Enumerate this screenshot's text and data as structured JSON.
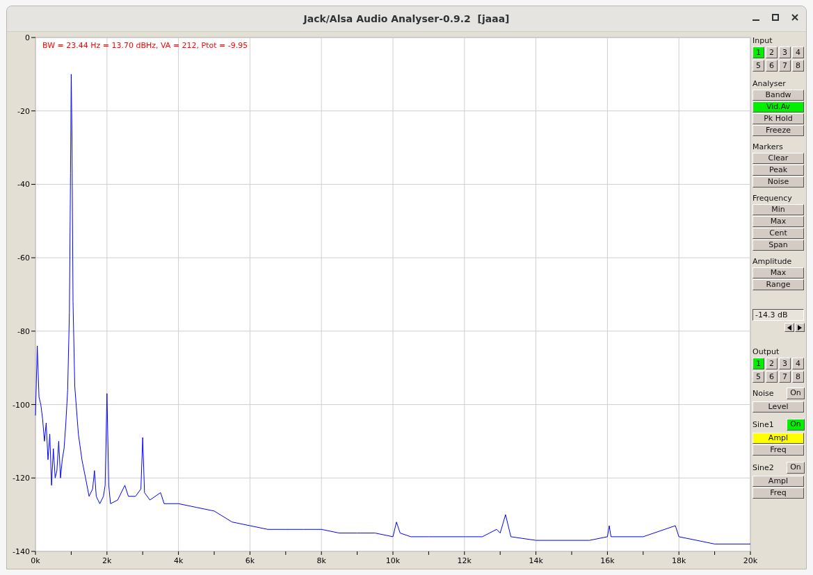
{
  "window": {
    "title": "Jack/Alsa Audio Analyser-0.9.2  [jaaa]"
  },
  "plot": {
    "readout": "BW = 23.44 Hz = 13.70 dBHz, VA = 212, Ptot = -9.95",
    "chart_data": {
      "type": "line",
      "xlim": [
        0,
        20000
      ],
      "ylim": [
        -140,
        0
      ],
      "xticks": [
        {
          "value": 0,
          "label": "0k"
        },
        {
          "value": 2000,
          "label": "2k"
        },
        {
          "value": 4000,
          "label": "4k"
        },
        {
          "value": 6000,
          "label": "6k"
        },
        {
          "value": 8000,
          "label": "8k"
        },
        {
          "value": 10000,
          "label": "10k"
        },
        {
          "value": 12000,
          "label": "12k"
        },
        {
          "value": 14000,
          "label": "14k"
        },
        {
          "value": 16000,
          "label": "16k"
        },
        {
          "value": 18000,
          "label": "18k"
        },
        {
          "value": 20000,
          "label": "20k"
        }
      ],
      "yticks": [
        0,
        -20,
        -40,
        -60,
        -80,
        -100,
        -120,
        -140
      ],
      "x": [
        0,
        50,
        100,
        150,
        200,
        250,
        300,
        350,
        400,
        450,
        500,
        550,
        600,
        650,
        700,
        750,
        800,
        850,
        900,
        950,
        980,
        1000,
        1020,
        1050,
        1100,
        1200,
        1300,
        1400,
        1500,
        1600,
        1650,
        1700,
        1800,
        1900,
        1950,
        2000,
        2050,
        2100,
        2300,
        2500,
        2600,
        2800,
        2950,
        3000,
        3050,
        3200,
        3500,
        3600,
        4000,
        4500,
        5000,
        5500,
        6000,
        6500,
        7000,
        7500,
        8000,
        8500,
        9000,
        9500,
        10000,
        10100,
        10200,
        10500,
        11000,
        12000,
        12500,
        12900,
        13000,
        13150,
        13300,
        14000,
        15000,
        15500,
        16000,
        16050,
        16100,
        17000,
        17900,
        18000,
        18500,
        19000,
        20000
      ],
      "grid": true,
      "series": [
        {
          "color": "#0000ff",
          "values": [
            -103,
            -84,
            -98,
            -100,
            -104,
            -110,
            -105,
            -115,
            -108,
            -122,
            -112,
            -120,
            -118,
            -110,
            -120,
            -115,
            -112,
            -105,
            -96,
            -75,
            -37,
            -10,
            -25,
            -72,
            -95,
            -108,
            -115,
            -120,
            -125,
            -123,
            -118,
            -125,
            -127,
            -125,
            -122,
            -97,
            -122,
            -127,
            -126,
            -122,
            -125,
            -125,
            -123,
            -109,
            -124,
            -126,
            -124,
            -127,
            -127,
            -128,
            -129,
            -132,
            -133,
            -134,
            -134,
            -134,
            -134,
            -135,
            -135,
            -135,
            -136,
            -132,
            -135,
            -136,
            -136,
            -136,
            -136,
            -134,
            -135,
            -130,
            -136,
            -137,
            -137,
            -137,
            -136,
            -133,
            -136,
            -136,
            -133,
            -136,
            -137,
            -138,
            -138
          ]
        }
      ]
    }
  },
  "panel": [
    {
      "kind": "heading",
      "text": "Input"
    },
    {
      "kind": "grid",
      "buttons": [
        {
          "label": "1",
          "selected": true
        },
        {
          "label": "2",
          "selected": false
        },
        {
          "label": "3",
          "selected": false
        },
        {
          "label": "4",
          "selected": false
        },
        {
          "label": "5",
          "selected": false
        },
        {
          "label": "6",
          "selected": false
        },
        {
          "label": "7",
          "selected": false
        },
        {
          "label": "8",
          "selected": false
        }
      ]
    },
    {
      "kind": "heading",
      "text": "Analyser"
    },
    {
      "kind": "button",
      "label": "Bandw",
      "on": false,
      "selected": false
    },
    {
      "kind": "button",
      "label": "Vid.Av",
      "on": true,
      "selected": false
    },
    {
      "kind": "button",
      "label": "Pk Hold",
      "on": false,
      "selected": false
    },
    {
      "kind": "button",
      "label": "Freeze",
      "on": false,
      "selected": false
    },
    {
      "kind": "heading",
      "text": "Markers"
    },
    {
      "kind": "button",
      "label": "Clear",
      "on": false,
      "selected": false
    },
    {
      "kind": "button",
      "label": "Peak",
      "on": false,
      "selected": false
    },
    {
      "kind": "button",
      "label": "Noise",
      "on": false,
      "selected": false
    },
    {
      "kind": "heading",
      "text": "Frequency"
    },
    {
      "kind": "button",
      "label": "Min",
      "on": false,
      "selected": false
    },
    {
      "kind": "button",
      "label": "Max",
      "on": false,
      "selected": false
    },
    {
      "kind": "button",
      "label": "Cent",
      "on": false,
      "selected": false
    },
    {
      "kind": "button",
      "label": "Span",
      "on": false,
      "selected": false
    },
    {
      "kind": "heading",
      "text": "Amplitude"
    },
    {
      "kind": "button",
      "label": "Max",
      "on": false,
      "selected": false
    },
    {
      "kind": "button",
      "label": "Range",
      "on": false,
      "selected": false
    },
    {
      "kind": "field",
      "value": "-14.3 dB"
    },
    {
      "kind": "arrows"
    },
    {
      "kind": "heading",
      "text": "Output"
    },
    {
      "kind": "grid",
      "buttons": [
        {
          "label": "1",
          "selected": true
        },
        {
          "label": "2",
          "selected": false
        },
        {
          "label": "3",
          "selected": false
        },
        {
          "label": "4",
          "selected": false
        },
        {
          "label": "5",
          "selected": false
        },
        {
          "label": "6",
          "selected": false
        },
        {
          "label": "7",
          "selected": false
        },
        {
          "label": "8",
          "selected": false
        }
      ]
    },
    {
      "kind": "toggle",
      "label": "Noise",
      "button": {
        "label": "On",
        "on": false
      }
    },
    {
      "kind": "button",
      "label": "Level",
      "on": false,
      "selected": false
    },
    {
      "kind": "toggle",
      "label": "Sine1",
      "button": {
        "label": "On",
        "on": true
      }
    },
    {
      "kind": "button",
      "label": "Ampl",
      "on": false,
      "selected": true
    },
    {
      "kind": "button",
      "label": "Freq",
      "on": false,
      "selected": false
    },
    {
      "kind": "toggle",
      "label": "Sine2",
      "button": {
        "label": "On",
        "on": false
      }
    },
    {
      "kind": "button",
      "label": "Ampl",
      "on": false,
      "selected": false
    },
    {
      "kind": "button",
      "label": "Freq",
      "on": false,
      "selected": false
    }
  ]
}
